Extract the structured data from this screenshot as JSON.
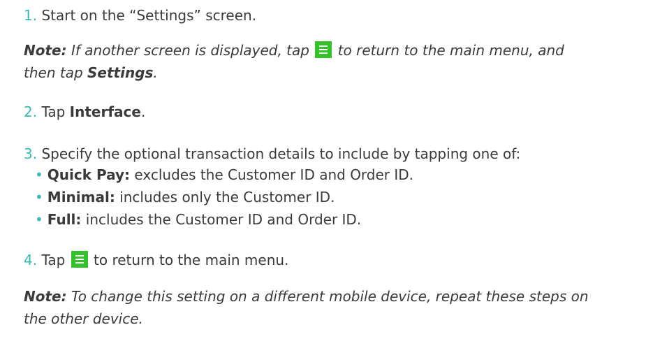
{
  "steps": [
    {
      "num": "1.",
      "text": "Start on the “Settings” screen.",
      "note": {
        "label": "Note:",
        "text_before_icon": " If another screen is displayed, tap ",
        "text_after_icon": " to return to the main menu, and",
        "line2_before": "then tap ",
        "line2_bold": "Settings",
        "line2_after": "."
      }
    },
    {
      "num": "2.",
      "text_before": "Tap ",
      "bold": "Interface",
      "text_after": "."
    },
    {
      "num": "3.",
      "text": "Specify the optional transaction details to include by tapping one of:",
      "bullets": [
        {
          "bold": "Quick Pay:",
          "text": " excludes the Customer ID and Order ID."
        },
        {
          "bold": "Minimal:",
          "text": " includes only the Customer ID."
        },
        {
          "bold": "Full:",
          "text": " includes the Customer ID and Order ID."
        }
      ]
    },
    {
      "num": "4.",
      "text_before": "Tap ",
      "text_after": " to return to the main menu.",
      "note": {
        "label": "Note:",
        "text": " To change this setting on a different mobile device, repeat these steps on",
        "line2": "the other device."
      }
    }
  ],
  "bullet_glyph": "•",
  "icon": "menu-icon",
  "colors": {
    "step_number": "#3cb8b2",
    "menu_icon_bg": "#35c12c",
    "text": "#3a3a3a"
  }
}
